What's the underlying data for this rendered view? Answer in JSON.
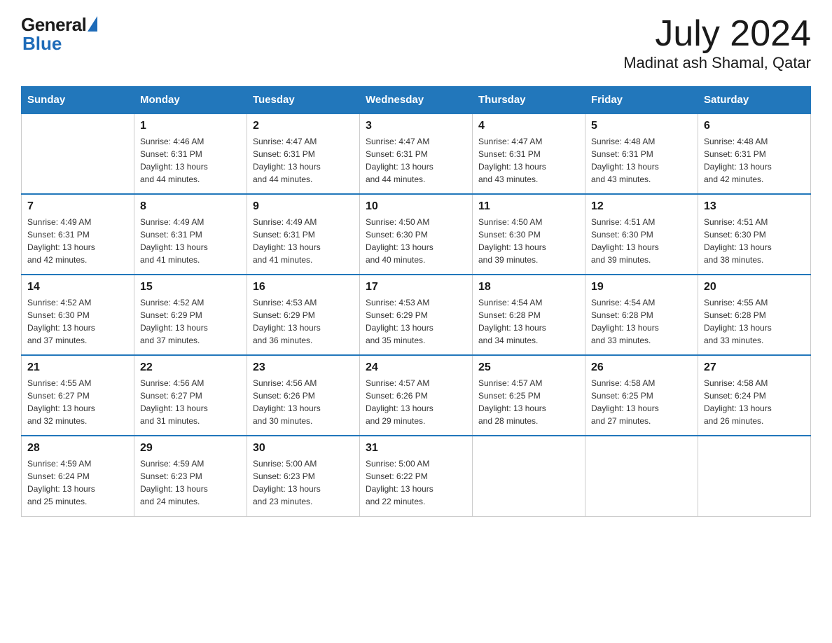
{
  "header": {
    "logo_general": "General",
    "logo_blue": "Blue",
    "month_year": "July 2024",
    "location": "Madinat ash Shamal, Qatar"
  },
  "days_of_week": [
    "Sunday",
    "Monday",
    "Tuesday",
    "Wednesday",
    "Thursday",
    "Friday",
    "Saturday"
  ],
  "weeks": [
    [
      {
        "day": "",
        "info": ""
      },
      {
        "day": "1",
        "info": "Sunrise: 4:46 AM\nSunset: 6:31 PM\nDaylight: 13 hours\nand 44 minutes."
      },
      {
        "day": "2",
        "info": "Sunrise: 4:47 AM\nSunset: 6:31 PM\nDaylight: 13 hours\nand 44 minutes."
      },
      {
        "day": "3",
        "info": "Sunrise: 4:47 AM\nSunset: 6:31 PM\nDaylight: 13 hours\nand 44 minutes."
      },
      {
        "day": "4",
        "info": "Sunrise: 4:47 AM\nSunset: 6:31 PM\nDaylight: 13 hours\nand 43 minutes."
      },
      {
        "day": "5",
        "info": "Sunrise: 4:48 AM\nSunset: 6:31 PM\nDaylight: 13 hours\nand 43 minutes."
      },
      {
        "day": "6",
        "info": "Sunrise: 4:48 AM\nSunset: 6:31 PM\nDaylight: 13 hours\nand 42 minutes."
      }
    ],
    [
      {
        "day": "7",
        "info": "Sunrise: 4:49 AM\nSunset: 6:31 PM\nDaylight: 13 hours\nand 42 minutes."
      },
      {
        "day": "8",
        "info": "Sunrise: 4:49 AM\nSunset: 6:31 PM\nDaylight: 13 hours\nand 41 minutes."
      },
      {
        "day": "9",
        "info": "Sunrise: 4:49 AM\nSunset: 6:31 PM\nDaylight: 13 hours\nand 41 minutes."
      },
      {
        "day": "10",
        "info": "Sunrise: 4:50 AM\nSunset: 6:30 PM\nDaylight: 13 hours\nand 40 minutes."
      },
      {
        "day": "11",
        "info": "Sunrise: 4:50 AM\nSunset: 6:30 PM\nDaylight: 13 hours\nand 39 minutes."
      },
      {
        "day": "12",
        "info": "Sunrise: 4:51 AM\nSunset: 6:30 PM\nDaylight: 13 hours\nand 39 minutes."
      },
      {
        "day": "13",
        "info": "Sunrise: 4:51 AM\nSunset: 6:30 PM\nDaylight: 13 hours\nand 38 minutes."
      }
    ],
    [
      {
        "day": "14",
        "info": "Sunrise: 4:52 AM\nSunset: 6:30 PM\nDaylight: 13 hours\nand 37 minutes."
      },
      {
        "day": "15",
        "info": "Sunrise: 4:52 AM\nSunset: 6:29 PM\nDaylight: 13 hours\nand 37 minutes."
      },
      {
        "day": "16",
        "info": "Sunrise: 4:53 AM\nSunset: 6:29 PM\nDaylight: 13 hours\nand 36 minutes."
      },
      {
        "day": "17",
        "info": "Sunrise: 4:53 AM\nSunset: 6:29 PM\nDaylight: 13 hours\nand 35 minutes."
      },
      {
        "day": "18",
        "info": "Sunrise: 4:54 AM\nSunset: 6:28 PM\nDaylight: 13 hours\nand 34 minutes."
      },
      {
        "day": "19",
        "info": "Sunrise: 4:54 AM\nSunset: 6:28 PM\nDaylight: 13 hours\nand 33 minutes."
      },
      {
        "day": "20",
        "info": "Sunrise: 4:55 AM\nSunset: 6:28 PM\nDaylight: 13 hours\nand 33 minutes."
      }
    ],
    [
      {
        "day": "21",
        "info": "Sunrise: 4:55 AM\nSunset: 6:27 PM\nDaylight: 13 hours\nand 32 minutes."
      },
      {
        "day": "22",
        "info": "Sunrise: 4:56 AM\nSunset: 6:27 PM\nDaylight: 13 hours\nand 31 minutes."
      },
      {
        "day": "23",
        "info": "Sunrise: 4:56 AM\nSunset: 6:26 PM\nDaylight: 13 hours\nand 30 minutes."
      },
      {
        "day": "24",
        "info": "Sunrise: 4:57 AM\nSunset: 6:26 PM\nDaylight: 13 hours\nand 29 minutes."
      },
      {
        "day": "25",
        "info": "Sunrise: 4:57 AM\nSunset: 6:25 PM\nDaylight: 13 hours\nand 28 minutes."
      },
      {
        "day": "26",
        "info": "Sunrise: 4:58 AM\nSunset: 6:25 PM\nDaylight: 13 hours\nand 27 minutes."
      },
      {
        "day": "27",
        "info": "Sunrise: 4:58 AM\nSunset: 6:24 PM\nDaylight: 13 hours\nand 26 minutes."
      }
    ],
    [
      {
        "day": "28",
        "info": "Sunrise: 4:59 AM\nSunset: 6:24 PM\nDaylight: 13 hours\nand 25 minutes."
      },
      {
        "day": "29",
        "info": "Sunrise: 4:59 AM\nSunset: 6:23 PM\nDaylight: 13 hours\nand 24 minutes."
      },
      {
        "day": "30",
        "info": "Sunrise: 5:00 AM\nSunset: 6:23 PM\nDaylight: 13 hours\nand 23 minutes."
      },
      {
        "day": "31",
        "info": "Sunrise: 5:00 AM\nSunset: 6:22 PM\nDaylight: 13 hours\nand 22 minutes."
      },
      {
        "day": "",
        "info": ""
      },
      {
        "day": "",
        "info": ""
      },
      {
        "day": "",
        "info": ""
      }
    ]
  ]
}
